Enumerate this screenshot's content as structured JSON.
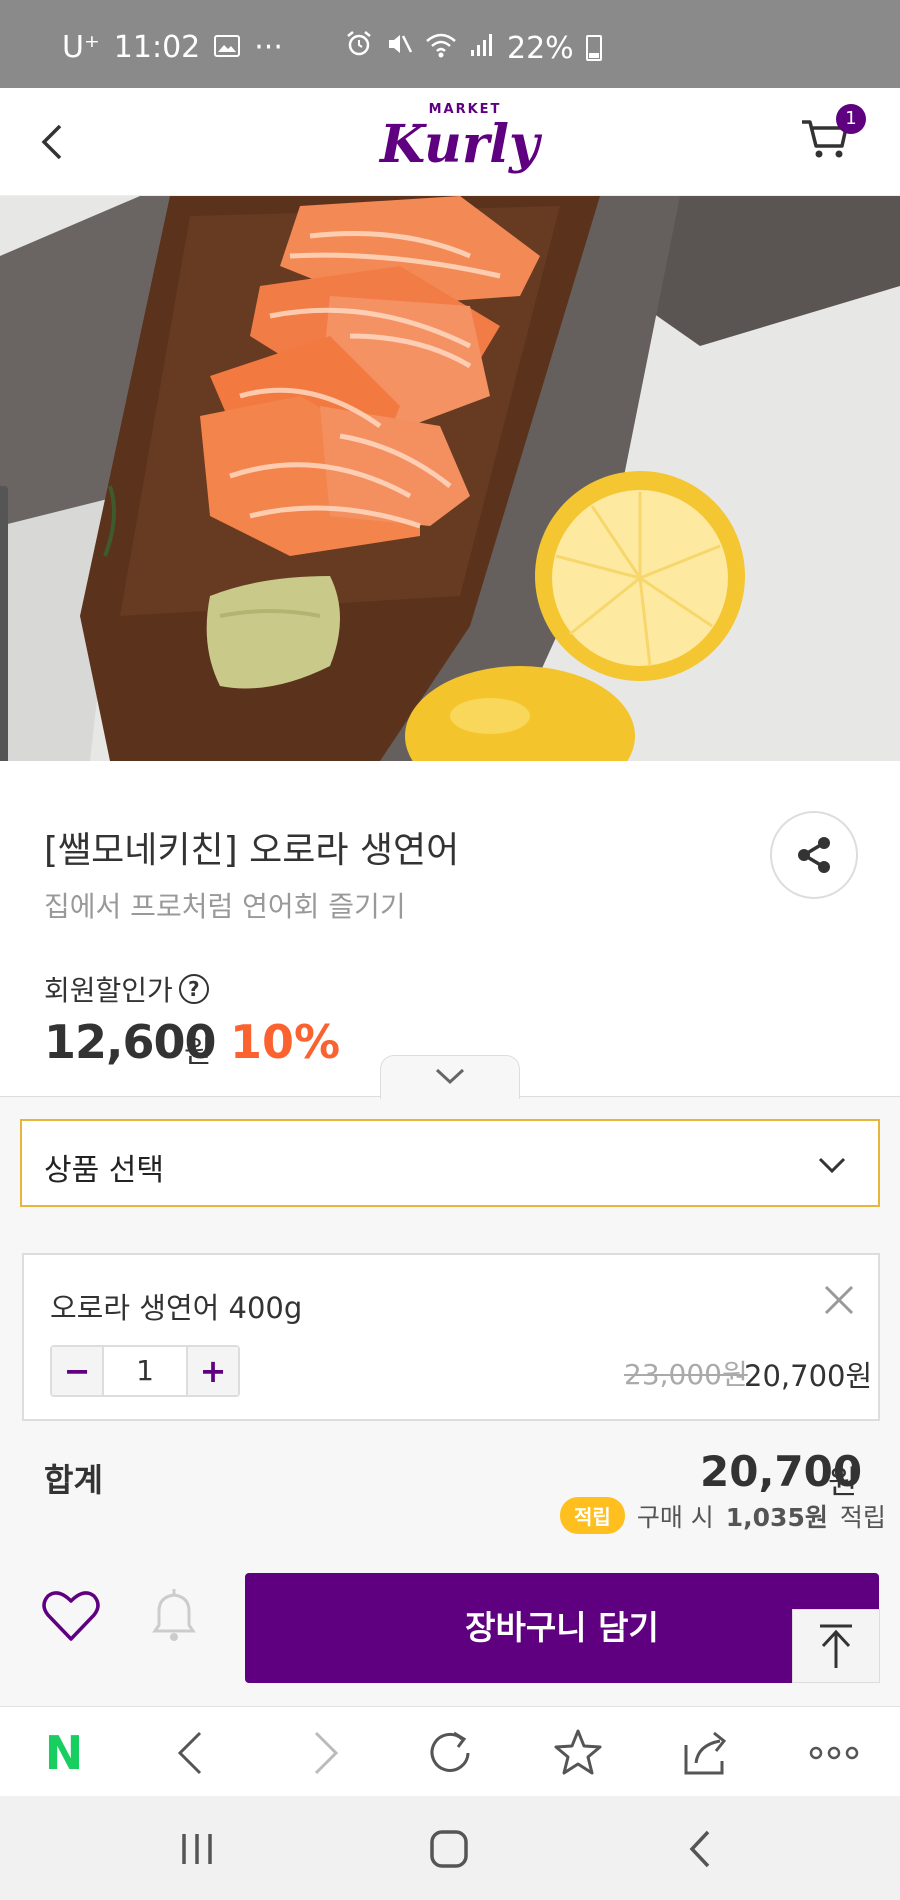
{
  "status_bar": {
    "carrier": "U⁺",
    "time": "11:02",
    "more": "···",
    "battery": "22%"
  },
  "header": {
    "logo_top": "MARKET",
    "logo_main": "Kurly",
    "cart_count": "1"
  },
  "product": {
    "title": "[쌜모네키친] 오로라 생연어",
    "subtitle": "집에서 프로처럼 연어회 즐기기",
    "member_price_label": "회원할인가",
    "help_icon": "?",
    "price": "12,600",
    "price_unit": "원",
    "discount": "10%"
  },
  "sheet": {
    "select_label": "상품 선택",
    "option": {
      "name": "오로라 생연어 400g",
      "minus": "−",
      "quantity": "1",
      "plus": "+",
      "original_price": "23,000원",
      "sale_price": "20,700원"
    },
    "total_label": "합계",
    "total_value": "20,700",
    "total_unit": "원",
    "points_badge": "적립",
    "points_text_1": "구매 시",
    "points_amount": "1,035원",
    "points_text_2": "적립",
    "add_to_cart": "장바구니 담기"
  },
  "browser_toolbar": {
    "home": "N"
  },
  "colors": {
    "brand": "#5f0080",
    "discount": "#fa622f",
    "select_border": "#e8b53b",
    "points_badge": "#ffc01f",
    "naver_green": "#19ce60"
  },
  "icons": [
    "back-icon",
    "cart-icon",
    "share-icon",
    "help-icon",
    "chevron-down-icon",
    "close-icon",
    "heart-icon",
    "bell-icon",
    "scroll-top-icon",
    "naver-icon",
    "browser-back-icon",
    "browser-forward-icon",
    "reload-icon",
    "bookmark-star-icon",
    "share-out-icon",
    "more-icon",
    "recent-apps-icon",
    "home-icon",
    "system-back-icon"
  ]
}
